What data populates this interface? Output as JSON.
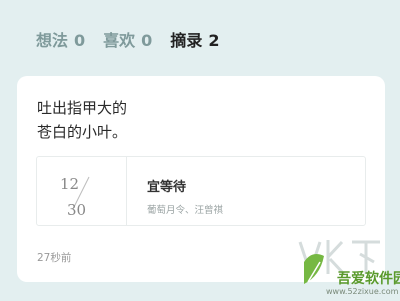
{
  "tabs": [
    {
      "label": "想法",
      "count": "0",
      "active": false
    },
    {
      "label": "喜欢",
      "count": "0",
      "active": false
    },
    {
      "label": "摘录",
      "count": "2",
      "active": true
    }
  ],
  "card": {
    "excerpt_line1": "吐出指甲大的",
    "excerpt_line2": "苍白的小叶。",
    "date_month": "12",
    "date_day": "30",
    "book_title": "宜等待",
    "book_meta": "葡萄月令、汪曾祺",
    "time_ago": "27秒前"
  },
  "watermark": {
    "site_name": "吾爱软件园",
    "url": "www.52zixue.com"
  }
}
